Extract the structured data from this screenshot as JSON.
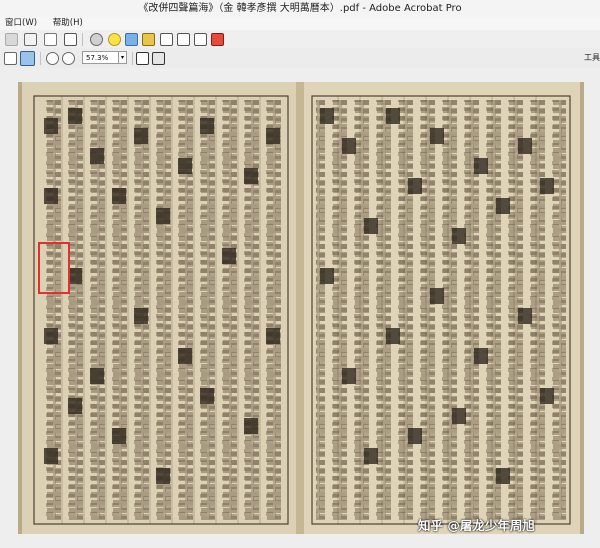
{
  "window": {
    "title": "《改併四聲篇海》（金 韓孝彥撰 大明萬曆本）.pdf - Adobe Acrobat Pro"
  },
  "menu": {
    "items": [
      "窗口(W)",
      "帮助(H)"
    ]
  },
  "toolbar": {
    "zoom_value": "57.3%",
    "right_label": "工具"
  },
  "document": {
    "watermark": "知乎 @屠龙少年周旭"
  }
}
